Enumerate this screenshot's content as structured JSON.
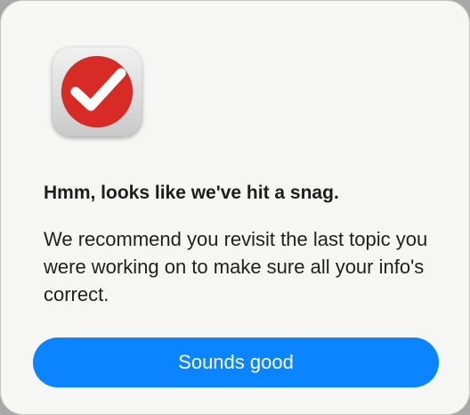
{
  "dialog": {
    "heading": "Hmm, looks like we've hit a snag.",
    "message": "We recommend you revisit the last topic you were working on to make sure all your info's correct.",
    "button_label": "Sounds good",
    "app_icon": "checkmark-icon"
  },
  "colors": {
    "button": "#0a84ff",
    "icon_red": "#d92b26",
    "background": "#f6f6f5"
  }
}
